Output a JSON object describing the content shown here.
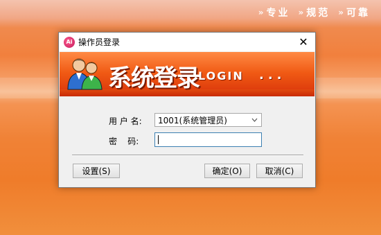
{
  "background": {
    "slogan": [
      "专业",
      "规范",
      "可靠"
    ],
    "chevron": "»"
  },
  "dialog": {
    "title": "操作员登录",
    "app_icon_text": "Ai",
    "close_symbol": "✕",
    "banner": {
      "title": "系统登录",
      "login": "LOGIN",
      "dots": "..."
    },
    "username_label": "用 户 名:",
    "username_value": "1001(系统管理员)",
    "password_label": "密    码:",
    "password_value": "",
    "buttons": {
      "settings": "设置(S)",
      "ok": "确定(O)",
      "cancel": "取消(C)"
    }
  },
  "colors": {
    "accent": "#ef7c2a",
    "banner": "#f05a14",
    "focus_border": "#3c7fb1"
  }
}
